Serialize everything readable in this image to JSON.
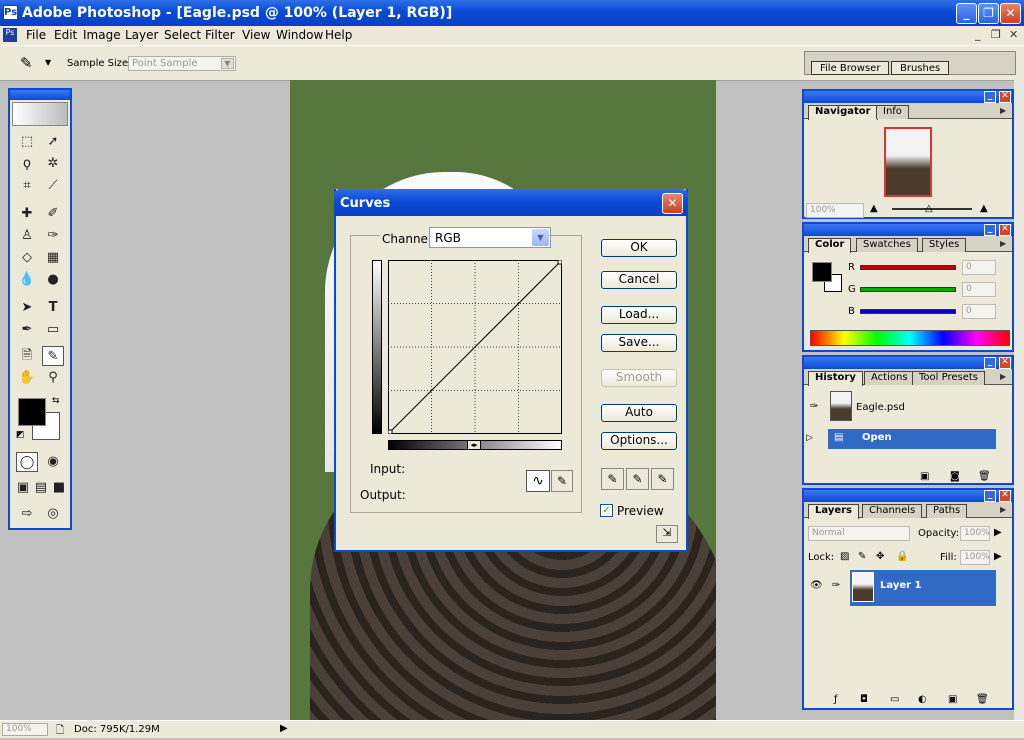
{
  "window": {
    "title": "Adobe Photoshop - [Eagle.psd @ 100% (Layer 1, RGB)]",
    "app_icon_letter": "Ps",
    "min": "_",
    "restore": "❐",
    "close": "✕"
  },
  "menu": {
    "items": [
      "File",
      "Edit",
      "Image",
      "Layer",
      "Select",
      "Filter",
      "View",
      "Window",
      "Help"
    ],
    "mdi_min": "_",
    "mdi_restore": "❐",
    "mdi_close": "✕"
  },
  "options": {
    "tool_icon": "eyedropper-icon",
    "sample_label": "Sample Size:",
    "sample_value": "Point Sample",
    "palette_tabs": [
      "File Browser",
      "Brushes"
    ]
  },
  "toolbox": {
    "tools": [
      "marquee-icon",
      "move-icon",
      "lasso-icon",
      "magic-wand-icon",
      "crop-icon",
      "slice-icon",
      "healing-icon",
      "brush-icon",
      "stamp-icon",
      "history-brush-icon",
      "eraser-icon",
      "gradient-icon",
      "blur-icon",
      "dodge-icon",
      "path-select-icon",
      "type-icon",
      "pen-icon",
      "shape-icon",
      "notes-icon",
      "eyedropper-icon",
      "hand-icon",
      "zoom-icon"
    ],
    "fg_color": "#000000",
    "bg_color": "#ffffff"
  },
  "curves": {
    "title": "Curves",
    "channel_label": "Channel:",
    "channel_value": "RGB",
    "input_label": "Input:",
    "output_label": "Output:",
    "buttons": {
      "ok": "OK",
      "cancel": "Cancel",
      "load": "Load...",
      "save": "Save...",
      "smooth": "Smooth",
      "auto": "Auto",
      "options": "Options..."
    },
    "preview_label": "Preview",
    "preview_checked": true
  },
  "navigator": {
    "tabs": [
      "Navigator",
      "Info"
    ],
    "zoom": "100%"
  },
  "color": {
    "tabs": [
      "Color",
      "Swatches",
      "Styles"
    ],
    "channels": [
      {
        "label": "R",
        "value": "0",
        "color": "#cc0000"
      },
      {
        "label": "G",
        "value": "0",
        "color": "#00aa00"
      },
      {
        "label": "B",
        "value": "0",
        "color": "#0000cc"
      }
    ]
  },
  "history": {
    "tabs": [
      "History",
      "Actions",
      "Tool Presets"
    ],
    "snapshot": "Eagle.psd",
    "states": [
      "Open"
    ]
  },
  "layers": {
    "tabs": [
      "Layers",
      "Channels",
      "Paths"
    ],
    "blend_mode": "Normal",
    "opacity_label": "Opacity:",
    "opacity": "100%",
    "lock_label": "Lock:",
    "fill_label": "Fill:",
    "fill": "100%",
    "layer_name": "Layer 1"
  },
  "status": {
    "zoom": "100%",
    "doc": "Doc: 795K/1.29M"
  }
}
